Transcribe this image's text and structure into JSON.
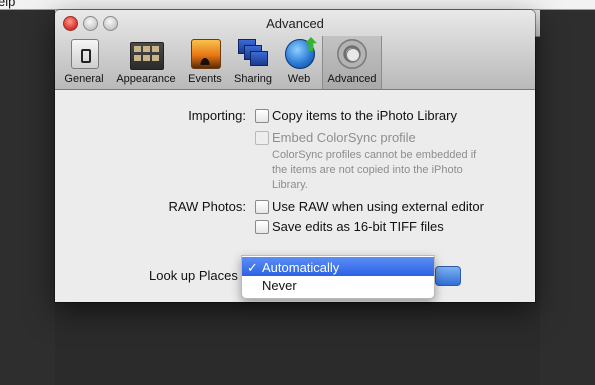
{
  "menubar": {
    "item": "elp"
  },
  "window": {
    "title": "Advanced"
  },
  "toolbar": {
    "items": [
      {
        "label": "General",
        "icon": "general-switch-icon"
      },
      {
        "label": "Appearance",
        "icon": "appearance-icon"
      },
      {
        "label": "Events",
        "icon": "events-icon"
      },
      {
        "label": "Sharing",
        "icon": "sharing-icon"
      },
      {
        "label": "Web",
        "icon": "web-globe-icon"
      },
      {
        "label": "Advanced",
        "icon": "gear-icon",
        "selected": true
      }
    ]
  },
  "importing": {
    "label": "Importing:",
    "copy": {
      "label": "Copy items to the iPhoto Library",
      "checked": false
    },
    "embed": {
      "label": "Embed ColorSync profile",
      "checked": false,
      "disabled": true
    },
    "note_lines": [
      "ColorSync profiles cannot be embedded if",
      "the items are not copied into the iPhoto",
      "Library."
    ]
  },
  "raw": {
    "label": "RAW Photos:",
    "use_raw": {
      "label": "Use RAW when using external editor",
      "checked": false
    },
    "save_tiff": {
      "label": "Save edits as 16-bit TIFF files",
      "checked": false
    }
  },
  "places": {
    "label": "Look up Places",
    "selected": "Automatically",
    "check_mark": "✓",
    "options": [
      "Automatically",
      "Never"
    ]
  },
  "colors": {
    "highlight": "#2c62e5",
    "close": "#e0443a"
  }
}
